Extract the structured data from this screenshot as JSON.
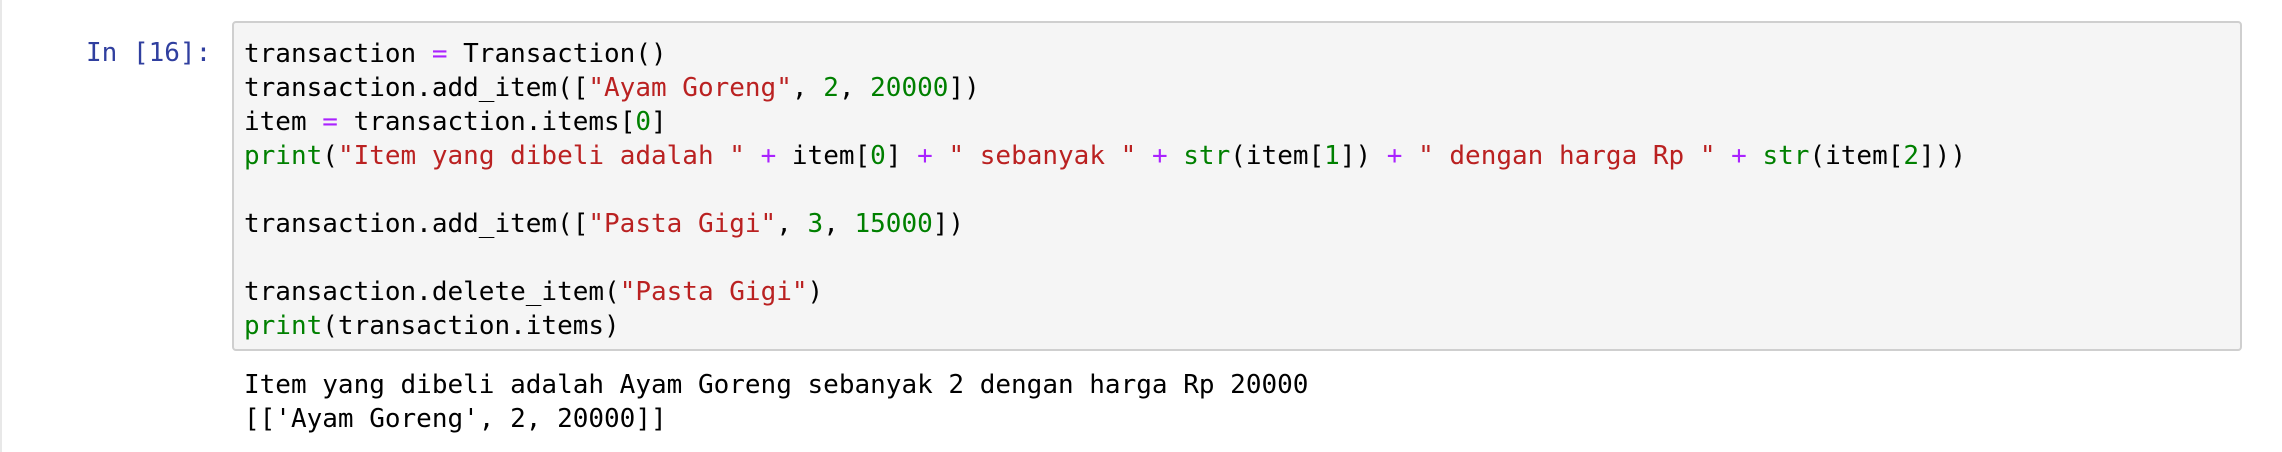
{
  "cell": {
    "prompt": "In [16]:",
    "code_lines": [
      [
        {
          "t": "transaction ",
          "k": "plain"
        },
        {
          "t": "=",
          "k": "kw-op"
        },
        {
          "t": " Transaction()",
          "k": "plain"
        }
      ],
      [
        {
          "t": "transaction.add_item([",
          "k": "plain"
        },
        {
          "t": "\"Ayam Goreng\"",
          "k": "str"
        },
        {
          "t": ", ",
          "k": "plain"
        },
        {
          "t": "2",
          "k": "num"
        },
        {
          "t": ", ",
          "k": "plain"
        },
        {
          "t": "20000",
          "k": "num"
        },
        {
          "t": "])",
          "k": "plain"
        }
      ],
      [
        {
          "t": "item ",
          "k": "plain"
        },
        {
          "t": "=",
          "k": "kw-op"
        },
        {
          "t": " transaction.items[",
          "k": "plain"
        },
        {
          "t": "0",
          "k": "num"
        },
        {
          "t": "]",
          "k": "plain"
        }
      ],
      [
        {
          "t": "print",
          "k": "builtin"
        },
        {
          "t": "(",
          "k": "plain"
        },
        {
          "t": "\"Item yang dibeli adalah \"",
          "k": "str"
        },
        {
          "t": " ",
          "k": "plain"
        },
        {
          "t": "+",
          "k": "kw-op"
        },
        {
          "t": " item[",
          "k": "plain"
        },
        {
          "t": "0",
          "k": "num"
        },
        {
          "t": "] ",
          "k": "plain"
        },
        {
          "t": "+",
          "k": "kw-op"
        },
        {
          "t": " ",
          "k": "plain"
        },
        {
          "t": "\" sebanyak \"",
          "k": "str"
        },
        {
          "t": " ",
          "k": "plain"
        },
        {
          "t": "+",
          "k": "kw-op"
        },
        {
          "t": " ",
          "k": "plain"
        },
        {
          "t": "str",
          "k": "builtin"
        },
        {
          "t": "(item[",
          "k": "plain"
        },
        {
          "t": "1",
          "k": "num"
        },
        {
          "t": "]) ",
          "k": "plain"
        },
        {
          "t": "+",
          "k": "kw-op"
        },
        {
          "t": " ",
          "k": "plain"
        },
        {
          "t": "\" dengan harga Rp \"",
          "k": "str"
        },
        {
          "t": " ",
          "k": "plain"
        },
        {
          "t": "+",
          "k": "kw-op"
        },
        {
          "t": " ",
          "k": "plain"
        },
        {
          "t": "str",
          "k": "builtin"
        },
        {
          "t": "(item[",
          "k": "plain"
        },
        {
          "t": "2",
          "k": "num"
        },
        {
          "t": "]))",
          "k": "plain"
        }
      ],
      [],
      [
        {
          "t": "transaction.add_item([",
          "k": "plain"
        },
        {
          "t": "\"Pasta Gigi\"",
          "k": "str"
        },
        {
          "t": ", ",
          "k": "plain"
        },
        {
          "t": "3",
          "k": "num"
        },
        {
          "t": ", ",
          "k": "plain"
        },
        {
          "t": "15000",
          "k": "num"
        },
        {
          "t": "])",
          "k": "plain"
        }
      ],
      [],
      [
        {
          "t": "transaction.delete_item(",
          "k": "plain"
        },
        {
          "t": "\"Pasta Gigi\"",
          "k": "str"
        },
        {
          "t": ")",
          "k": "plain"
        }
      ],
      [
        {
          "t": "print",
          "k": "builtin"
        },
        {
          "t": "(transaction.items)",
          "k": "plain"
        }
      ]
    ],
    "output_lines": [
      "Item yang dibeli adalah Ayam Goreng sebanyak 2 dengan harga Rp 20000",
      "[['Ayam Goreng', 2, 20000]]"
    ]
  },
  "colors": {
    "prompt": "#303f9f",
    "operator": "#aa22ff",
    "string": "#ba2121",
    "number": "#008000",
    "builtin": "#008000",
    "input_background": "#f5f5f5",
    "input_border": "#cfcfcf"
  }
}
